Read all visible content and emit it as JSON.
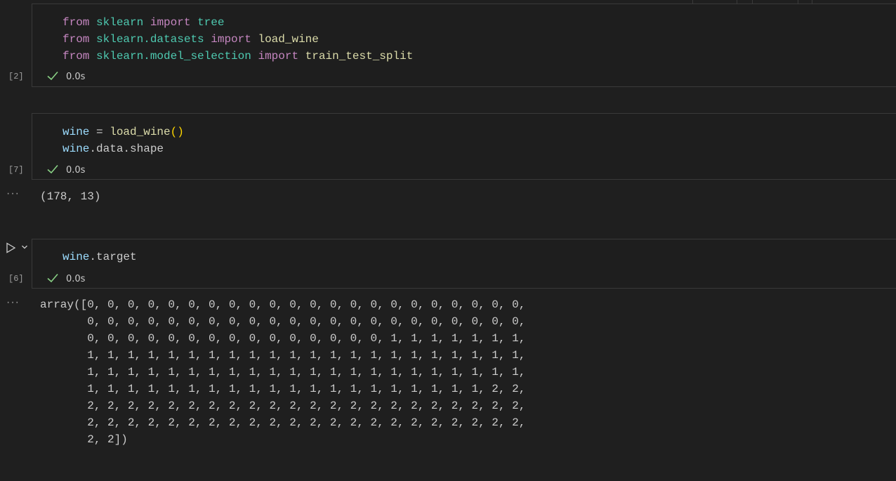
{
  "cells": [
    {
      "exec_count": "[2]",
      "status": "0.0s",
      "code_lines": [
        [
          "from",
          "sklearn",
          "import",
          "tree"
        ],
        [
          "from",
          "sklearn.datasets",
          "import",
          "load_wine"
        ],
        [
          "from",
          "sklearn.model_selection",
          "import",
          "train_test_split"
        ]
      ]
    },
    {
      "exec_count": "[7]",
      "status": "0.0s",
      "line1": {
        "var": "wine",
        "op": " = ",
        "fn": "load_wine",
        "paren": "()"
      },
      "line2": {
        "var": "wine",
        "rest": ".data.shape"
      },
      "output_ellipsis": "···",
      "output": "(178, 13)"
    },
    {
      "exec_count": "[6]",
      "status": "0.0s",
      "line1": {
        "var": "wine",
        "rest": ".target"
      },
      "output_ellipsis": "···",
      "output": "array([0, 0, 0, 0, 0, 0, 0, 0, 0, 0, 0, 0, 0, 0, 0, 0, 0, 0, 0, 0, 0, 0,\n       0, 0, 0, 0, 0, 0, 0, 0, 0, 0, 0, 0, 0, 0, 0, 0, 0, 0, 0, 0, 0, 0,\n       0, 0, 0, 0, 0, 0, 0, 0, 0, 0, 0, 0, 0, 0, 0, 1, 1, 1, 1, 1, 1, 1,\n       1, 1, 1, 1, 1, 1, 1, 1, 1, 1, 1, 1, 1, 1, 1, 1, 1, 1, 1, 1, 1, 1,\n       1, 1, 1, 1, 1, 1, 1, 1, 1, 1, 1, 1, 1, 1, 1, 1, 1, 1, 1, 1, 1, 1,\n       1, 1, 1, 1, 1, 1, 1, 1, 1, 1, 1, 1, 1, 1, 1, 1, 1, 1, 1, 1, 2, 2,\n       2, 2, 2, 2, 2, 2, 2, 2, 2, 2, 2, 2, 2, 2, 2, 2, 2, 2, 2, 2, 2, 2,\n       2, 2, 2, 2, 2, 2, 2, 2, 2, 2, 2, 2, 2, 2, 2, 2, 2, 2, 2, 2, 2, 2,\n       2, 2])"
    }
  ],
  "icons": {
    "check": "check-icon",
    "run": "run-icon",
    "chevron": "chevron-down-icon"
  },
  "colors": {
    "background": "#1f1f1f",
    "cell_background": "#1e1e1e",
    "success": "#89d185",
    "keyword": "#c586c0",
    "module": "#4ec9b0",
    "variable": "#9cdcfe",
    "function": "#dcdcaa"
  }
}
